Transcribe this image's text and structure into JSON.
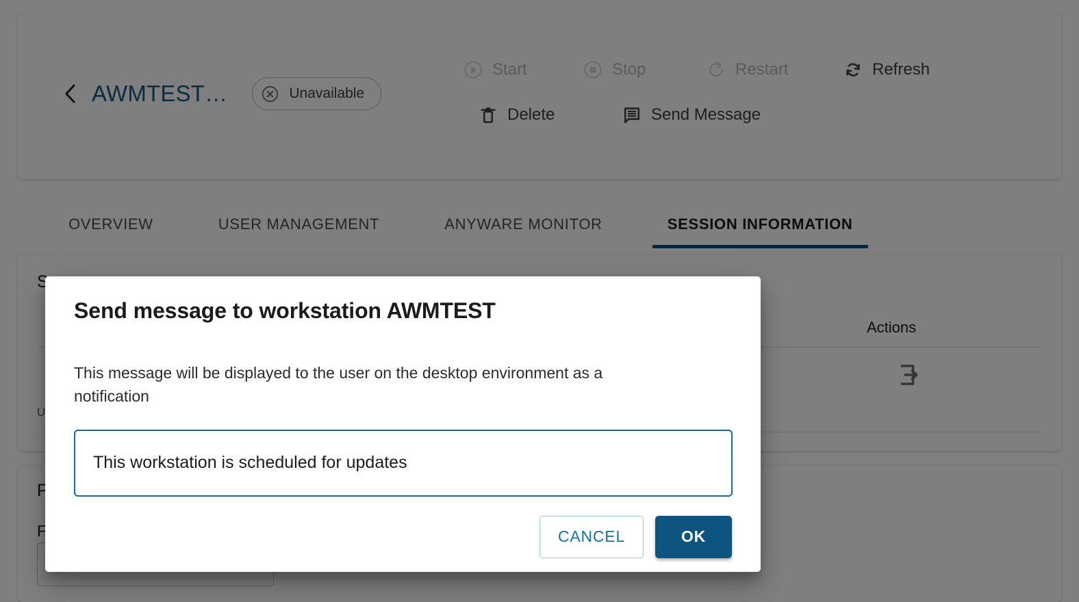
{
  "header": {
    "back_icon": "chevron-left-icon",
    "workstation_name": "AWMTEST…",
    "status": {
      "icon": "cancel-circle-icon",
      "label": "Unavailable"
    },
    "actions": [
      {
        "id": "start",
        "icon": "play-circle-icon",
        "label": "Start",
        "disabled": true
      },
      {
        "id": "stop",
        "icon": "stop-circle-icon",
        "label": "Stop",
        "disabled": true
      },
      {
        "id": "restart",
        "icon": "restart-icon",
        "label": "Restart",
        "disabled": true
      },
      {
        "id": "refresh",
        "icon": "refresh-icon",
        "label": "Refresh",
        "disabled": false
      },
      {
        "id": "delete",
        "icon": "trash-icon",
        "label": "Delete",
        "disabled": false
      },
      {
        "id": "send-message",
        "icon": "message-icon",
        "label": "Send Message",
        "disabled": false
      }
    ]
  },
  "tabs": [
    {
      "id": "overview",
      "label": "OVERVIEW",
      "active": false
    },
    {
      "id": "user-management",
      "label": "USER MANAGEMENT",
      "active": false
    },
    {
      "id": "anyware-monitor",
      "label": "ANYWARE MONITOR",
      "active": false
    },
    {
      "id": "session-information",
      "label": "SESSION INFORMATION",
      "active": true
    }
  ],
  "session_card": {
    "section_title": "S",
    "column_header_actions": "Actions",
    "row_label": "U",
    "row_action_icon": "login-arrow-icon"
  },
  "pool_card": {
    "section_title": "P",
    "field_label": "F"
  },
  "dialog": {
    "title": "Send message to workstation AWMTEST",
    "description": "This message will be displayed to the user on the desktop environment as a notification",
    "message_value": "This workstation is scheduled for updates",
    "message_placeholder": "",
    "cancel_label": "CANCEL",
    "ok_label": "OK"
  },
  "colors": {
    "accent_blue": "#0d5a82",
    "tab_underline": "#0d5074",
    "primary_button": "#0d5580",
    "input_focus_border": "#0d6ea0",
    "cancel_text": "#1372ab",
    "scrim": "rgba(0,0,0,0.50)"
  }
}
